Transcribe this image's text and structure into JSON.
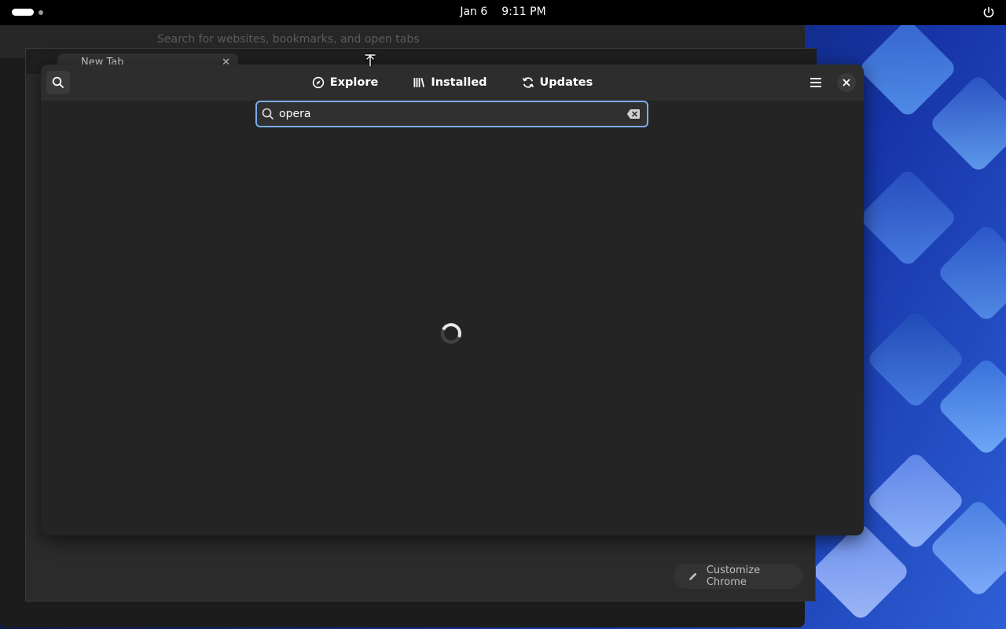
{
  "topbar": {
    "date": "Jan 6",
    "time": "9:11 PM",
    "icons": [
      "activities-indicator",
      "power-icon"
    ]
  },
  "chrome": {
    "omnibox_placeholder": "Search for websites, bookmarks, and open tabs",
    "tab_title": "New Tab",
    "customize_label": "Customize Chrome"
  },
  "software": {
    "tabs": [
      {
        "label": "Explore",
        "icon": "compass-icon"
      },
      {
        "label": "Installed",
        "icon": "library-icon"
      },
      {
        "label": "Updates",
        "icon": "refresh-icon"
      }
    ],
    "search_value": "opera",
    "loading": true
  },
  "colors": {
    "accent": "#78aeed",
    "window_bg": "#242424",
    "header_bg": "#2d2d2d"
  }
}
